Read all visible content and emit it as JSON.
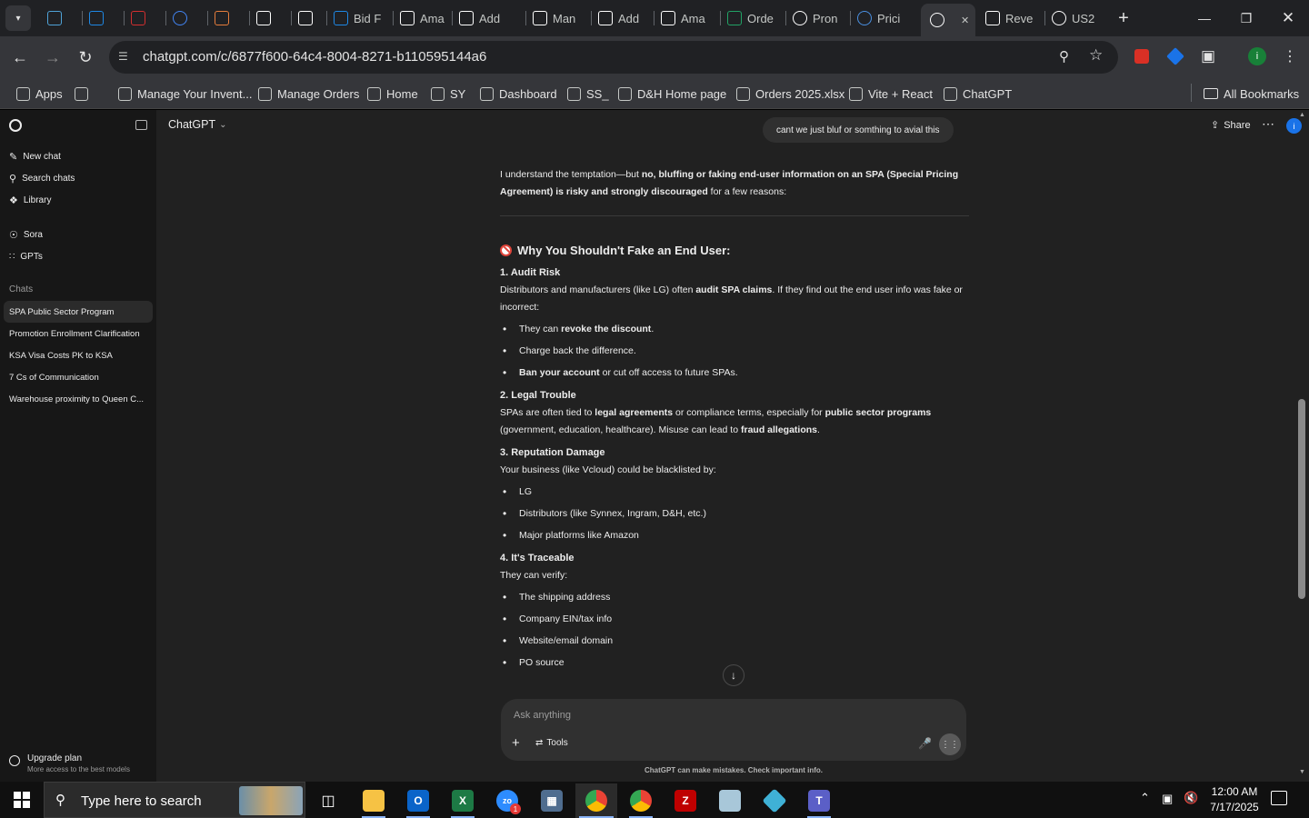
{
  "browser": {
    "tabs": [
      {
        "title": "",
        "icon": "tab-icon-cyan",
        "color": "#4fa3d8"
      },
      {
        "title": "",
        "icon": "tab-icon-ec",
        "color": "#1e88e5"
      },
      {
        "title": "",
        "icon": "tab-icon-dh",
        "color": "#d32f2f"
      },
      {
        "title": "",
        "icon": "tab-icon-google-docs",
        "color": "#4285f4"
      },
      {
        "title": "",
        "icon": "tab-icon-stack",
        "color": "#e57d3c"
      },
      {
        "title": "",
        "icon": "amazon-icon",
        "color": "#ffffff"
      },
      {
        "title": "",
        "icon": "amazon-icon",
        "color": "#ffffff"
      },
      {
        "title": "Bid F",
        "icon": "tab-icon-ec",
        "color": "#1e88e5"
      },
      {
        "title": "Ama",
        "icon": "amazon-icon",
        "color": "#ffffff"
      },
      {
        "title": "Add",
        "icon": "amazon-icon",
        "color": "#ffffff"
      },
      {
        "title": "Man",
        "icon": "amazon-icon",
        "color": "#ffffff"
      },
      {
        "title": "Add",
        "icon": "amazon-icon",
        "color": "#ffffff"
      },
      {
        "title": "Ama",
        "icon": "amazon-icon",
        "color": "#ffffff"
      },
      {
        "title": "Orde",
        "icon": "excel-icon",
        "color": "#21a366"
      },
      {
        "title": "Pron",
        "icon": "chatgpt-icon",
        "color": "#ffffff"
      },
      {
        "title": "Prici",
        "icon": "tab-icon-dollar",
        "color": "#4a90e2"
      },
      {
        "title": "",
        "icon": "chatgpt-icon",
        "color": "#ffffff",
        "active": true
      },
      {
        "title": "Reve",
        "icon": "amazon-icon",
        "color": "#ffffff"
      },
      {
        "title": "US2",
        "icon": "google-icon",
        "color": "#ffffff"
      }
    ],
    "url": "chatgpt.com/c/6877f600-64c4-8004-8271-b110595144a6",
    "bookmarks": [
      {
        "label": "Apps",
        "icon": "apps-grid-icon"
      },
      {
        "label": "",
        "icon": "tab-groups-icon"
      },
      {
        "label": "Manage Your Invent...",
        "icon": "amazon-icon"
      },
      {
        "label": "Manage Orders",
        "icon": "amazon-icon"
      },
      {
        "label": "Home",
        "icon": "google-docs-icon"
      },
      {
        "label": "SY",
        "icon": "ec-icon"
      },
      {
        "label": "Dashboard",
        "icon": "dashboard-icon"
      },
      {
        "label": "SS_",
        "icon": "stack-icon"
      },
      {
        "label": "D&H Home page",
        "icon": "dh-icon"
      },
      {
        "label": "Orders 2025.xlsx",
        "icon": "excel-icon"
      },
      {
        "label": "Vite + React",
        "icon": "dollar-icon"
      },
      {
        "label": "ChatGPT",
        "icon": "chatgpt-icon"
      }
    ],
    "all_bookmarks": "All Bookmarks"
  },
  "sidebar": {
    "new_chat": "New chat",
    "search_chats": "Search chats",
    "library": "Library",
    "sora": "Sora",
    "gpts": "GPTs",
    "chats_header": "Chats",
    "chats": [
      "SPA Public Sector Program",
      "Promotion Enrollment Clarification",
      "KSA Visa Costs PK to KSA",
      "7 Cs of Communication",
      "Warehouse proximity to Queen C..."
    ],
    "upgrade_title": "Upgrade plan",
    "upgrade_sub": "More access to the best models"
  },
  "header": {
    "model": "ChatGPT",
    "share": "Share",
    "avatar_letter": "i"
  },
  "conversation": {
    "user_message": "cant we just bluf or somthing to avial this",
    "intro_1": "I understand the temptation—but ",
    "intro_b1": "no, bluffing or faking end-user information on an SPA (Special Pricing Agreement) is risky and strongly discouraged",
    "intro_2": " for a few reasons:",
    "heading": "Why You Shouldn't Fake an End User:",
    "s1_title": "1. Audit Risk",
    "s1_p1": "Distributors and manufacturers (like LG) often ",
    "s1_b1": "audit SPA claims",
    "s1_p2": ". If they find out the end user info was fake or incorrect:",
    "s1_items": [
      {
        "pre": "They can ",
        "b": "revoke the discount",
        "post": "."
      },
      {
        "pre": "Charge back the difference.",
        "b": "",
        "post": ""
      },
      {
        "pre": "",
        "b": "Ban your account",
        "post": " or cut off access to future SPAs."
      }
    ],
    "s2_title": "2. Legal Trouble",
    "s2_p1": "SPAs are often tied to ",
    "s2_b1": "legal agreements",
    "s2_p2": " or compliance terms, especially for ",
    "s2_b2": "public sector programs",
    "s2_p3": " (government, education, healthcare). Misuse can lead to ",
    "s2_b3": "fraud allegations",
    "s2_p4": ".",
    "s3_title": "3. Reputation Damage",
    "s3_intro": "Your business (like Vcloud) could be blacklisted by:",
    "s3_items": [
      "LG",
      "Distributors (like Synnex, Ingram, D&H, etc.)",
      "Major platforms like Amazon"
    ],
    "s4_title": "4. It's Traceable",
    "s4_intro": "They can verify:",
    "s4_items": [
      "The shipping address",
      "Company EIN/tax info",
      "Website/email domain",
      "PO source"
    ]
  },
  "composer": {
    "placeholder": "Ask anything",
    "tools": "Tools",
    "disclaimer": "ChatGPT can make mistakes. Check important info."
  },
  "taskbar": {
    "search_placeholder": "Type here to search",
    "time": "12:00 AM",
    "date": "7/17/2025",
    "zoom_badge": "1"
  }
}
